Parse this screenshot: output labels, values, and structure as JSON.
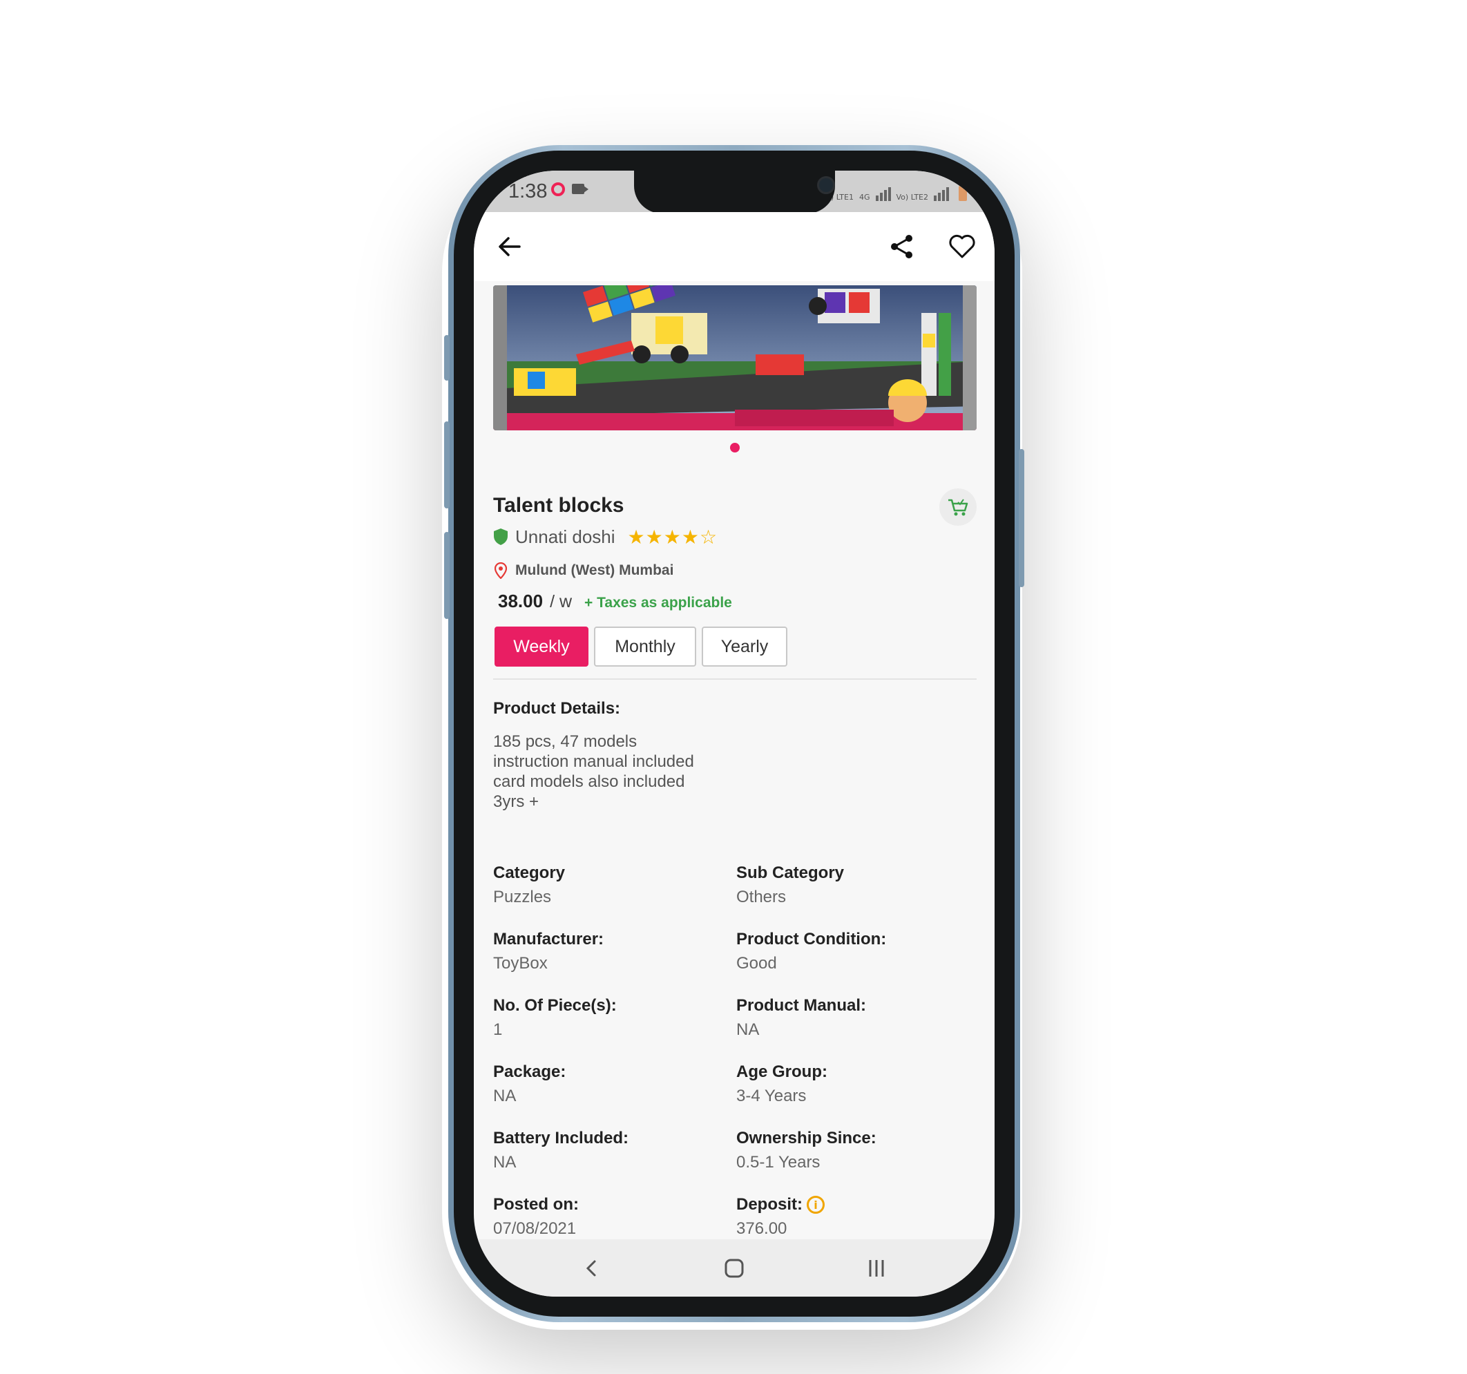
{
  "status_bar": {
    "time": "1:38",
    "network_labels": [
      "Vo) LTE1",
      "4G",
      "Vo) LTE2"
    ]
  },
  "toolbar": {
    "back_icon": "arrow-left-icon",
    "share_icon": "share-icon",
    "favorite_icon": "heart-icon"
  },
  "carousel": {
    "slide_count": 1,
    "active_index": 0,
    "active_color": "#e91e63"
  },
  "product": {
    "title": "Talent blocks",
    "seller": "Unnati doshi",
    "rating": 4,
    "rating_max": 5,
    "rating_stars": "★★★★☆",
    "location": "Mulund (West) Mumbai",
    "price": "38.00",
    "price_unit": "/ w",
    "tax_note": "+ Taxes as applicable"
  },
  "rental_periods": {
    "options": [
      "Weekly",
      "Monthly",
      "Yearly"
    ],
    "selected": "Weekly"
  },
  "details": {
    "heading": "Product Details:",
    "lines": [
      "185 pcs, 47 models",
      "instruction manual included",
      "card models also included",
      "3yrs +"
    ]
  },
  "specs": {
    "category_label": "Category",
    "category_value": "Puzzles",
    "subcategory_label": "Sub Category",
    "subcategory_value": "Others",
    "manufacturer_label": "Manufacturer:",
    "manufacturer_value": "ToyBox",
    "condition_label": "Product Condition:",
    "condition_value": "Good",
    "pieces_label": "No. Of Piece(s):",
    "pieces_value": "1",
    "manual_label": "Product Manual:",
    "manual_value": "NA",
    "package_label": "Package:",
    "package_value": "NA",
    "age_label": "Age Group:",
    "age_value": "3-4 Years",
    "battery_label": "Battery Included:",
    "battery_value": "NA",
    "ownership_label": "Ownership Since:",
    "ownership_value": "0.5-1 Years",
    "posted_label": "Posted on:",
    "posted_value": "07/08/2021",
    "deposit_label": "Deposit:",
    "deposit_value": "376.00"
  },
  "colors": {
    "accent": "#e91e63",
    "tax_green": "#3ba24a",
    "star": "#f5b400",
    "verified": "#43a047",
    "location_pin": "#e53935"
  }
}
